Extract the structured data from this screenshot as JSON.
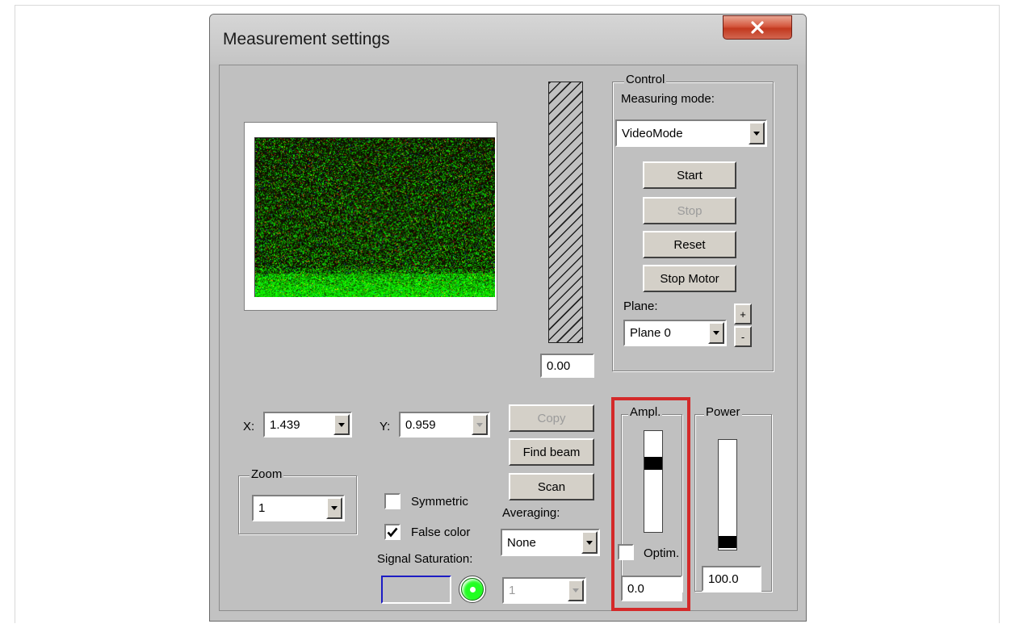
{
  "window": {
    "title": "Measurement settings"
  },
  "coords": {
    "x_label": "X:",
    "x_value": "1.439",
    "y_label": "Y:",
    "y_value": "0.959"
  },
  "buttons": {
    "copy": "Copy",
    "find_beam": "Find beam",
    "scan": "Scan"
  },
  "intensity_value": "0.00",
  "zoom": {
    "legend": "Zoom",
    "value": "1"
  },
  "options": {
    "symmetric": "Symmetric",
    "symmetric_checked": false,
    "false_color": "False color",
    "false_color_checked": true
  },
  "averaging": {
    "label": "Averaging:",
    "value": "None",
    "secondary_value": "1"
  },
  "signal": {
    "label": "Signal Saturation:",
    "led_color": "#22ff22"
  },
  "control": {
    "legend": "Control",
    "mode_label": "Measuring mode:",
    "mode_value": "VideoMode",
    "start": "Start",
    "stop": "Stop",
    "reset": "Reset",
    "stop_motor": "Stop Motor",
    "plane_label": "Plane:",
    "plane_value": "Plane 0",
    "plane_plus": "+",
    "plane_minus": "-"
  },
  "ampl": {
    "legend": "Ampl.",
    "optim_label": "Optim.",
    "optim_checked": false,
    "value": "0.0"
  },
  "power": {
    "legend": "Power",
    "value": "100.0"
  },
  "highlight_color": "#d42a2a"
}
